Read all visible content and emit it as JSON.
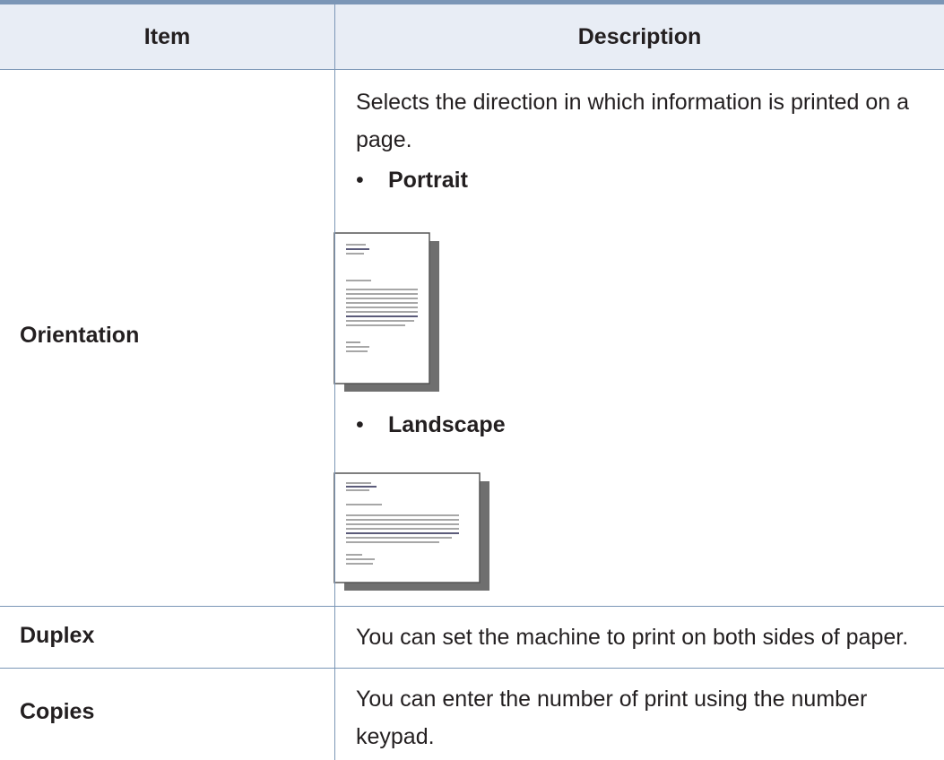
{
  "table": {
    "headers": {
      "item": "Item",
      "description": "Description"
    },
    "rows": [
      {
        "item": "Orientation",
        "description": "Selects the direction in which information is printed on a page.",
        "options": [
          {
            "bullet": "•",
            "label": "Portrait",
            "icon": "portrait-page-icon"
          },
          {
            "bullet": "•",
            "label": "Landscape",
            "icon": "landscape-page-icon"
          }
        ]
      },
      {
        "item": "Duplex",
        "description": "You can set the machine to print on both sides of paper."
      },
      {
        "item": "Copies",
        "description": "You can enter the number of print using the number keypad."
      }
    ]
  },
  "colors": {
    "rule": "#7b96b6",
    "header_bg": "#e8edf5",
    "text": "#231f20",
    "shadow": "#6f6f6f"
  }
}
